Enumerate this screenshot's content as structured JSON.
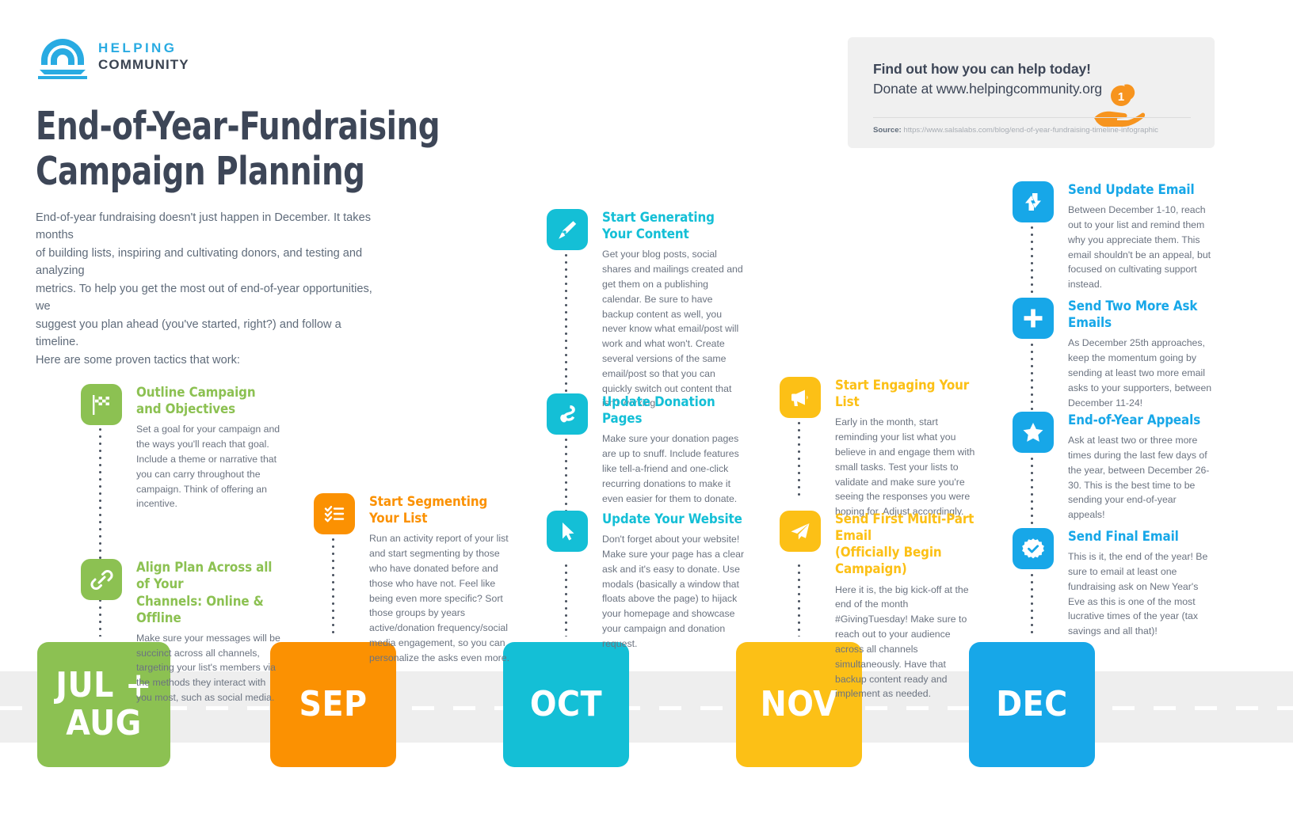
{
  "brand": {
    "logo_line1": "HELPING",
    "logo_line2": "COMMUNITY",
    "logo_icon": "arch-community-icon"
  },
  "header": {
    "title_line1": "End-of-Year-Fundraising",
    "title_line2": "Campaign Planning",
    "intro_lines": [
      "End-of-year fundraising doesn't just happen in December. It takes months",
      "of building lists, inspiring and cultivating donors, and testing and analyzing",
      "metrics. To help you get the most out of end-of-year opportunities, we",
      "suggest you plan ahead (you've started, right?) and follow a timeline.",
      "Here are some proven tactics that work:"
    ]
  },
  "donate_box": {
    "headline": "Find out how you can help today!",
    "subline": "Donate at www.helpingcommunity.org",
    "icon": "hand-with-coin-icon",
    "source_label": "Source:",
    "source_url": "https://www.salsalabs.com/blog/end-of-year-fundraising-timeline-infographic"
  },
  "colors": {
    "green": "#8cc152",
    "orange": "#fb9102",
    "cyan": "#14bfd6",
    "yellow": "#fcc016",
    "blue": "#17a7e8",
    "dark": "#3d4657",
    "body_text": "#6b7380",
    "road": "#eeeeee",
    "panel": "#f0f0f0"
  },
  "months": [
    {
      "label": "JUL +\nAUG",
      "color": "#8cc152",
      "key": "jul-aug"
    },
    {
      "label": "SEP",
      "color": "#fb9102",
      "key": "sep"
    },
    {
      "label": "OCT",
      "color": "#14bfd6",
      "key": "oct"
    },
    {
      "label": "NOV",
      "color": "#fcc016",
      "key": "nov"
    },
    {
      "label": "DEC",
      "color": "#17a7e8",
      "key": "dec"
    }
  ],
  "timeline": {
    "jul_aug": [
      {
        "icon": "checkered-flag-icon",
        "title": "Outline Campaign\nand Objectives",
        "desc": "Set a goal for your campaign and the ways you'll reach that goal. Include a theme or narrative that you can carry throughout the campaign. Think of offering an incentive."
      },
      {
        "icon": "link-chain-icon",
        "title": "Align Plan Across all of Your\nChannels: Online & Offline",
        "desc": "Make sure your messages will be succinct across all channels, targeting your list's members via the methods they interact with you most, such as social media."
      }
    ],
    "sep": [
      {
        "icon": "checklist-icon",
        "title": "Start Segmenting Your List",
        "desc": "Run an activity report of your list and start segmenting by those who have donated before and those who have not. Feel like being even more specific? Sort those groups by years active/donation frequency/social media engagement, so you can personalize the asks even more."
      }
    ],
    "oct": [
      {
        "icon": "pen-nib-icon",
        "title": "Start Generating\nYour Content",
        "desc": "Get your blog posts, social shares and mailings created and get them on a publishing calendar. Be sure to have backup content as well, you never know what email/post will work and what won't. Create several versions of the same email/post so that you can quickly switch out content that isn't working."
      },
      {
        "icon": "money-hand-icon",
        "title": "Update Donation Pages",
        "desc": "Make sure your donation pages are up to snuff. Include features like tell-a-friend and one-click recurring donations to make it even easier for them to donate."
      },
      {
        "icon": "cursor-arrow-icon",
        "title": "Update Your Website",
        "desc": "Don't forget about your website! Make sure your page has a clear ask and it's easy to donate. Use modals (basically a window that floats above the page) to hijack your homepage and showcase your campaign and donation request."
      }
    ],
    "nov": [
      {
        "icon": "megaphone-icon",
        "title": "Start Engaging Your List",
        "desc": "Early in the month, start reminding your list what you believe in and engage them with small tasks. Test your lists to validate and make sure you're seeing the responses you were hoping for. Adjust accordingly."
      },
      {
        "icon": "paper-plane-icon",
        "title": "Send First Multi-Part Email\n(Officially Begin Campaign)",
        "desc": "Here it is, the big kick-off at the end of the month #GivingTuesday! Make sure to reach out to your audience across all channels simultaneously. Have that backup content ready and implement as needed."
      }
    ],
    "dec": [
      {
        "icon": "refresh-arrows-icon",
        "title": "Send Update Email",
        "desc": "Between December 1-10, reach out to your list and remind them why you appreciate them. This email shouldn't be an appeal, but focused on cultivating support instead."
      },
      {
        "icon": "plus-icon",
        "title": "Send Two More Ask Emails",
        "desc": "As December 25th approaches, keep the momentum going by sending at least two more email asks to your supporters, between December 11-24!"
      },
      {
        "icon": "star-icon",
        "title": "End-of-Year Appeals",
        "desc": "Ask at least two or three more times during the last few days of the year, between December 26-30. This is the best time to be sending your end-of-year appeals!"
      },
      {
        "icon": "check-badge-icon",
        "title": "Send Final Email",
        "desc": "This is it, the end of the year! Be sure to email at least one fundraising ask on New Year's Eve as this is one of the most lucrative times of the year (tax savings and all that)!"
      }
    ]
  }
}
